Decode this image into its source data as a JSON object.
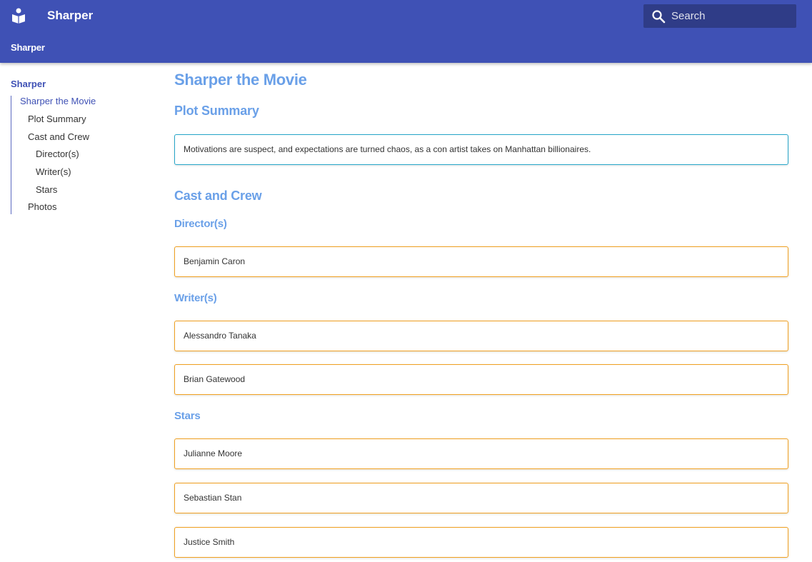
{
  "header": {
    "site_title": "Sharper",
    "section_title": "Sharper",
    "search_placeholder": "Search"
  },
  "sidebar": {
    "root": "Sharper",
    "items": [
      {
        "label": "Sharper the Movie"
      },
      {
        "label": "Plot Summary"
      },
      {
        "label": "Cast and Crew"
      },
      {
        "label": "Director(s)"
      },
      {
        "label": "Writer(s)"
      },
      {
        "label": "Stars"
      },
      {
        "label": "Photos"
      }
    ]
  },
  "content": {
    "title": "Sharper the Movie",
    "plot_heading": "Plot Summary",
    "plot_text": "Motivations are suspect, and expectations are turned chaos, as a con artist takes on Manhattan billionaires.",
    "cast_heading": "Cast and Crew",
    "directors_heading": "Director(s)",
    "directors": [
      "Benjamin Caron"
    ],
    "writers_heading": "Writer(s)",
    "writers": [
      "Alessandro Tanaka",
      "Brian Gatewood"
    ],
    "stars_heading": "Stars",
    "stars": [
      "Julianne Moore",
      "Sebastian Stan",
      "Justice Smith"
    ]
  },
  "colors": {
    "header_bg": "#3f51b5",
    "heading": "#6aa0e8",
    "plot_border": "#26a6c9",
    "person_border": "#f0a020"
  }
}
